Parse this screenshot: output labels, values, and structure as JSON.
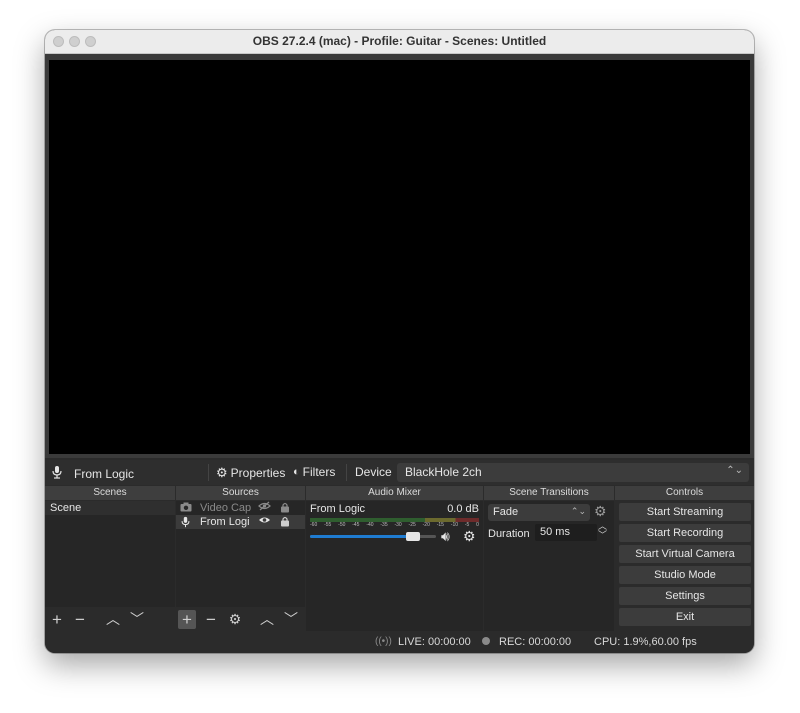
{
  "window": {
    "title": "OBS 27.2.4 (mac) - Profile: Guitar - Scenes: Untitled"
  },
  "source_toolbar": {
    "source_name": "From Logic",
    "properties_label": "Properties",
    "filters_label": "Filters",
    "device_label": "Device",
    "device_value": "BlackHole 2ch"
  },
  "docks": {
    "scenes": {
      "header": "Scenes",
      "items": [
        "Scene"
      ]
    },
    "sources": {
      "header": "Sources",
      "items": [
        {
          "label": "Video Cap",
          "type_icon": "camera-icon",
          "visible": false
        },
        {
          "label": "From Logi",
          "type_icon": "microphone-icon",
          "visible": true
        }
      ]
    },
    "audio_mixer": {
      "header": "Audio Mixer",
      "channel": "From Logic",
      "level": "0.0 dB",
      "volume_fraction": 0.82,
      "scale": [
        "-60",
        "-55",
        "-50",
        "-45",
        "-40",
        "-35",
        "-30",
        "-25",
        "-20",
        "-15",
        "-10",
        "-5",
        "0"
      ]
    },
    "transitions": {
      "header": "Scene Transitions",
      "selected": "Fade",
      "duration_label": "Duration",
      "duration_value": "50 ms"
    },
    "controls": {
      "header": "Controls",
      "buttons": [
        "Start Streaming",
        "Start Recording",
        "Start Virtual Camera",
        "Studio Mode",
        "Settings",
        "Exit"
      ]
    }
  },
  "status": {
    "live": "LIVE: 00:00:00",
    "rec": "REC: 00:00:00",
    "cpu": "CPU: 1.9%,60.00 fps"
  },
  "colors": {
    "background": "#2b2b2b",
    "preview": "#000000",
    "volume_slider": "#1f7cd1"
  }
}
